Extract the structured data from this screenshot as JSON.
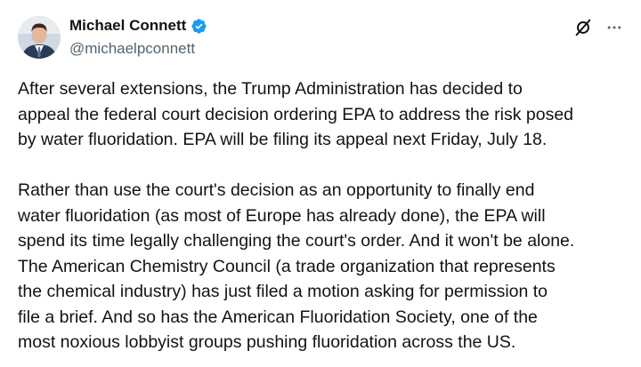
{
  "author": {
    "display_name": "Michael Connett",
    "handle": "@michaelpconnett",
    "verified": true,
    "avatar_icon": "profile-photo",
    "verified_icon": "verified-badge-icon"
  },
  "actions": {
    "grok_icon": "grok-icon",
    "more_icon": "more-options-icon"
  },
  "colors": {
    "text": "#0f1419",
    "secondary_text": "#536471",
    "verified_blue": "#1d9bf0"
  },
  "tweet": {
    "paragraphs": [
      "After several extensions, the Trump Administration has decided to\nappeal the federal court decision ordering EPA to address the risk posed\nby water fluoridation. EPA will be filing its appeal next Friday, July 18.",
      "Rather than use the court's decision as an opportunity to finally end\nwater fluoridation (as most of Europe has already done), the EPA will\nspend its time legally challenging the court's order. And it won't be alone.\nThe American Chemistry Council (a trade organization that represents\nthe chemical industry) has just filed a motion asking for permission to\nfile a brief. And so has the American Fluoridation Society, one of the\nmost noxious lobbyist groups pushing fluoridation across the US."
    ]
  }
}
